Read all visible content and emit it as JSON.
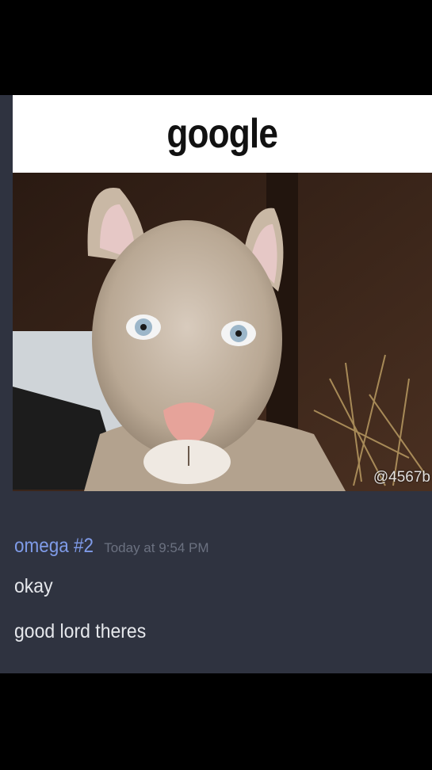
{
  "meme": {
    "caption": "google",
    "watermark": "@4567b"
  },
  "message": {
    "username": "omega #2",
    "timestamp": "Today at 9:54 PM",
    "lines": [
      "okay",
      "good lord theres"
    ]
  },
  "colors": {
    "background": "#000000",
    "chat_bg": "#2f3340",
    "username": "#7f9be8",
    "message_text": "#e6e8ec",
    "timestamp": "#6b7180"
  }
}
